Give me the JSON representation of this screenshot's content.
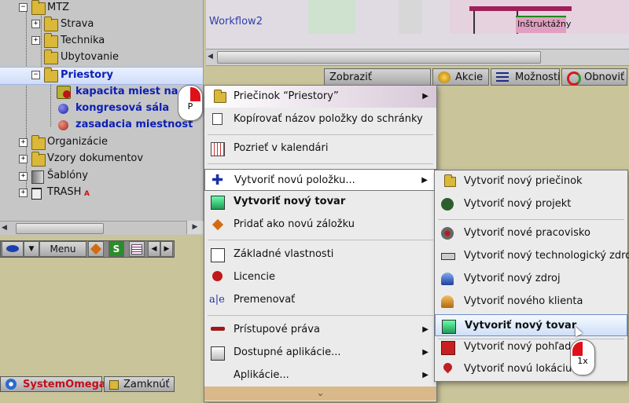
{
  "tree": {
    "items": [
      {
        "label": "MTZ"
      },
      {
        "label": "Strava"
      },
      {
        "label": "Technika"
      },
      {
        "label": "Ubytovanie"
      },
      {
        "label": "Priestory"
      },
      {
        "label": "kapacita miest na"
      },
      {
        "label": "kongresová sála"
      },
      {
        "label": "zasadacia miestnosť"
      },
      {
        "label": "Organizácie"
      },
      {
        "label": "Vzory dokumentov"
      },
      {
        "label": "Šablóny"
      },
      {
        "label": "TRASH"
      }
    ],
    "trash_badge": "A",
    "expand_symbol": "+",
    "collapse_symbol": "−"
  },
  "mini_toolbar": {
    "menu_label": "Menu",
    "s_label": "S"
  },
  "workflow": {
    "label": "Workflow2",
    "event_label": "Inštruktážny"
  },
  "top_toolbar": {
    "show_reality": "Zobraziť skutočnosť",
    "actions": "Akcie",
    "options": "Možnosti",
    "refresh": "Obnoviť"
  },
  "context_menu": {
    "items": [
      {
        "label": "Priečinok “Priestory”",
        "has_submenu": true
      },
      {
        "label": "Kopírovať názov položky do schránky"
      },
      {
        "label": "Pozrieť v kalendári"
      },
      {
        "label": "Vytvoriť novú položku...",
        "has_submenu": true
      },
      {
        "label": "Vytvoriť nový tovar"
      },
      {
        "label": "Pridať ako novú záložku"
      },
      {
        "label": "Základné vlastnosti"
      },
      {
        "label": "Licencie"
      },
      {
        "label": "Premenovať"
      },
      {
        "label": "Prístupové práva",
        "has_submenu": true
      },
      {
        "label": "Dostupné aplikácie...",
        "has_submenu": true
      },
      {
        "label": "Aplikácie...",
        "has_submenu": true
      }
    ],
    "submenu_arrow": "▶",
    "more_symbol": "⌄"
  },
  "submenu": {
    "items": [
      {
        "label": "Vytvoriť nový priečinok"
      },
      {
        "label": "Vytvoriť nový projekt"
      },
      {
        "label": "Vytvoriť nové pracovisko"
      },
      {
        "label": "Vytvoriť nový technologický zdroj"
      },
      {
        "label": "Vytvoriť nový zdroj"
      },
      {
        "label": "Vytvoriť nového klienta"
      },
      {
        "label": "Vytvoriť nový tovar"
      },
      {
        "label": "Vytvoriť nový pohľad"
      },
      {
        "label": "Vytvoriť novú lokáciu"
      }
    ]
  },
  "mouse_hints": {
    "right_click": "P",
    "left_click": "1x"
  },
  "status": {
    "app": "SystemOmega",
    "lock": "Zamknúť"
  },
  "colors": {
    "accent_blue": "#0b1fb5",
    "mouse_red": "#e0101a",
    "brand_red": "#c0101a"
  }
}
